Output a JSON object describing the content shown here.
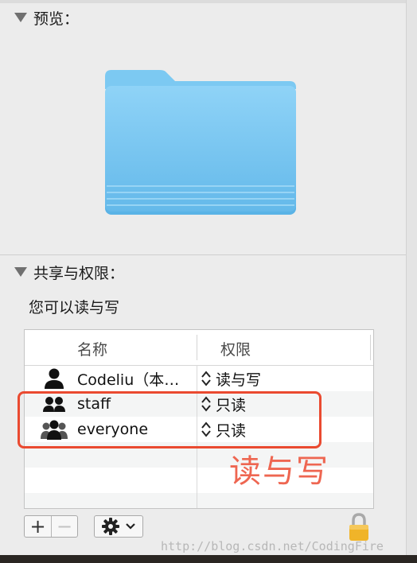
{
  "preview_section": {
    "title": "预览："
  },
  "sharing_section": {
    "title": "共享与权限：",
    "status_text": "您可以读与写"
  },
  "table": {
    "headers": {
      "name": "名称",
      "privilege": "权限"
    },
    "rows": [
      {
        "name": "Codeliu（本…",
        "privilege": "读与写",
        "icon": "single-user-icon"
      },
      {
        "name": "staff",
        "privilege": "只读",
        "icon": "group-icon"
      },
      {
        "name": "everyone",
        "privilege": "只读",
        "icon": "everyone-icon"
      }
    ]
  },
  "annotation": {
    "text": "读与写",
    "color": "#ee6651"
  },
  "toolbar": {
    "add_label": "+",
    "remove_label": "−"
  },
  "watermark": {
    "text": "http://blog.csdn.net/CodingFire"
  },
  "colors": {
    "folder": "#6cc0f0",
    "callout": "#ea4a30",
    "background": "#ececec"
  }
}
